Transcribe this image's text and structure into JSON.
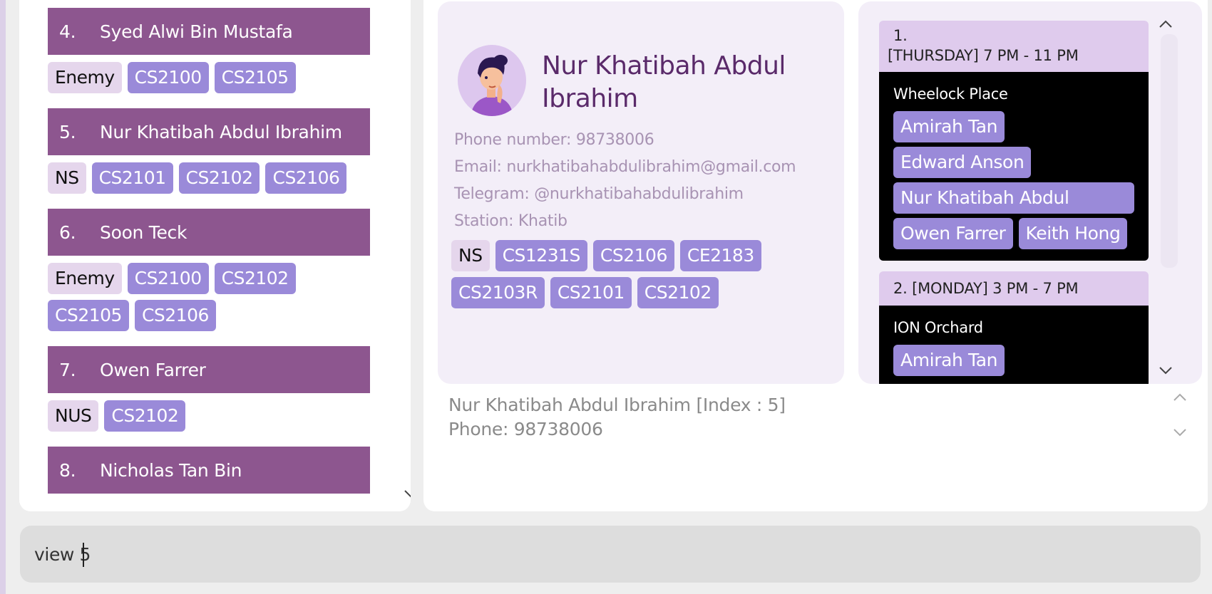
{
  "contact_list": {
    "persons": [
      {
        "index": "4.",
        "name": "Syed Alwi Bin Mustafa",
        "tags": [
          {
            "label": "Enemy",
            "kind": "group"
          },
          {
            "label": "CS2100",
            "kind": "module"
          },
          {
            "label": "CS2105",
            "kind": "module"
          }
        ]
      },
      {
        "index": "5.",
        "name": "Nur Khatibah Abdul Ibrahim",
        "tags": [
          {
            "label": "NS",
            "kind": "group"
          },
          {
            "label": "CS2101",
            "kind": "module"
          },
          {
            "label": "CS2102",
            "kind": "module"
          },
          {
            "label": "CS2106",
            "kind": "module"
          }
        ]
      },
      {
        "index": "6.",
        "name": "Soon Teck",
        "tags": [
          {
            "label": "Enemy",
            "kind": "group"
          },
          {
            "label": "CS2100",
            "kind": "module"
          },
          {
            "label": "CS2102",
            "kind": "module"
          },
          {
            "label": "CS2105",
            "kind": "module"
          },
          {
            "label": "CS2106",
            "kind": "module"
          }
        ]
      },
      {
        "index": "7.",
        "name": "Owen Farrer",
        "tags": [
          {
            "label": "NUS",
            "kind": "group"
          },
          {
            "label": "CS2102",
            "kind": "module"
          }
        ]
      },
      {
        "index": "8.",
        "name": "Nicholas Tan Bin",
        "tags": []
      }
    ]
  },
  "profile": {
    "name": "Nur Khatibah Abdul Ibrahim",
    "phone": "Phone number: 98738006",
    "email": "Email: nurkhatibahabdulibrahim@gmail.com",
    "telegram": "Telegram: @nurkhatibahabdulibrahim",
    "station": "Station: Khatib",
    "tags": [
      {
        "label": "NS",
        "kind": "group"
      },
      {
        "label": "CS1231S",
        "kind": "module"
      },
      {
        "label": "CS2106",
        "kind": "module"
      },
      {
        "label": "CE2183",
        "kind": "module"
      },
      {
        "label": "CS2103R",
        "kind": "module"
      },
      {
        "label": "CS2101",
        "kind": "module"
      },
      {
        "label": "CS2102",
        "kind": "module"
      }
    ]
  },
  "schedule": {
    "slots": [
      {
        "index": "1.",
        "time": "[THURSDAY] 7 PM - 11 PM",
        "location": "Wheelock Place",
        "members": [
          "Amirah Tan",
          "Edward Anson",
          "Nur Khatibah Abdul Ibrahim",
          "Owen Farrer",
          "Keith Hong"
        ]
      },
      {
        "index": "2.",
        "time": "[MONDAY] 3 PM - 7 PM",
        "location": "ION Orchard",
        "members": [
          "Amirah Tan"
        ]
      }
    ]
  },
  "result": {
    "line1": "Nur Khatibah Abdul Ibrahim [Index : 5]",
    "line2": "Phone: 98738006"
  },
  "command": {
    "value": "view 5"
  },
  "colors": {
    "person_header": "#8d568f",
    "group_tag": "#e5d6ec",
    "module_tag": "#9a8ad9",
    "card_background": "#f3eef8",
    "slot_body": "#000000"
  },
  "icons": {
    "list_scroll_down": "chevron-down-icon",
    "schedule_scroll_up": "chevron-up-icon",
    "schedule_scroll_down": "chevron-down-icon",
    "result_scroll_up": "chevron-up-icon",
    "result_scroll_down": "chevron-down-icon",
    "avatar": "avatar-illustration"
  }
}
